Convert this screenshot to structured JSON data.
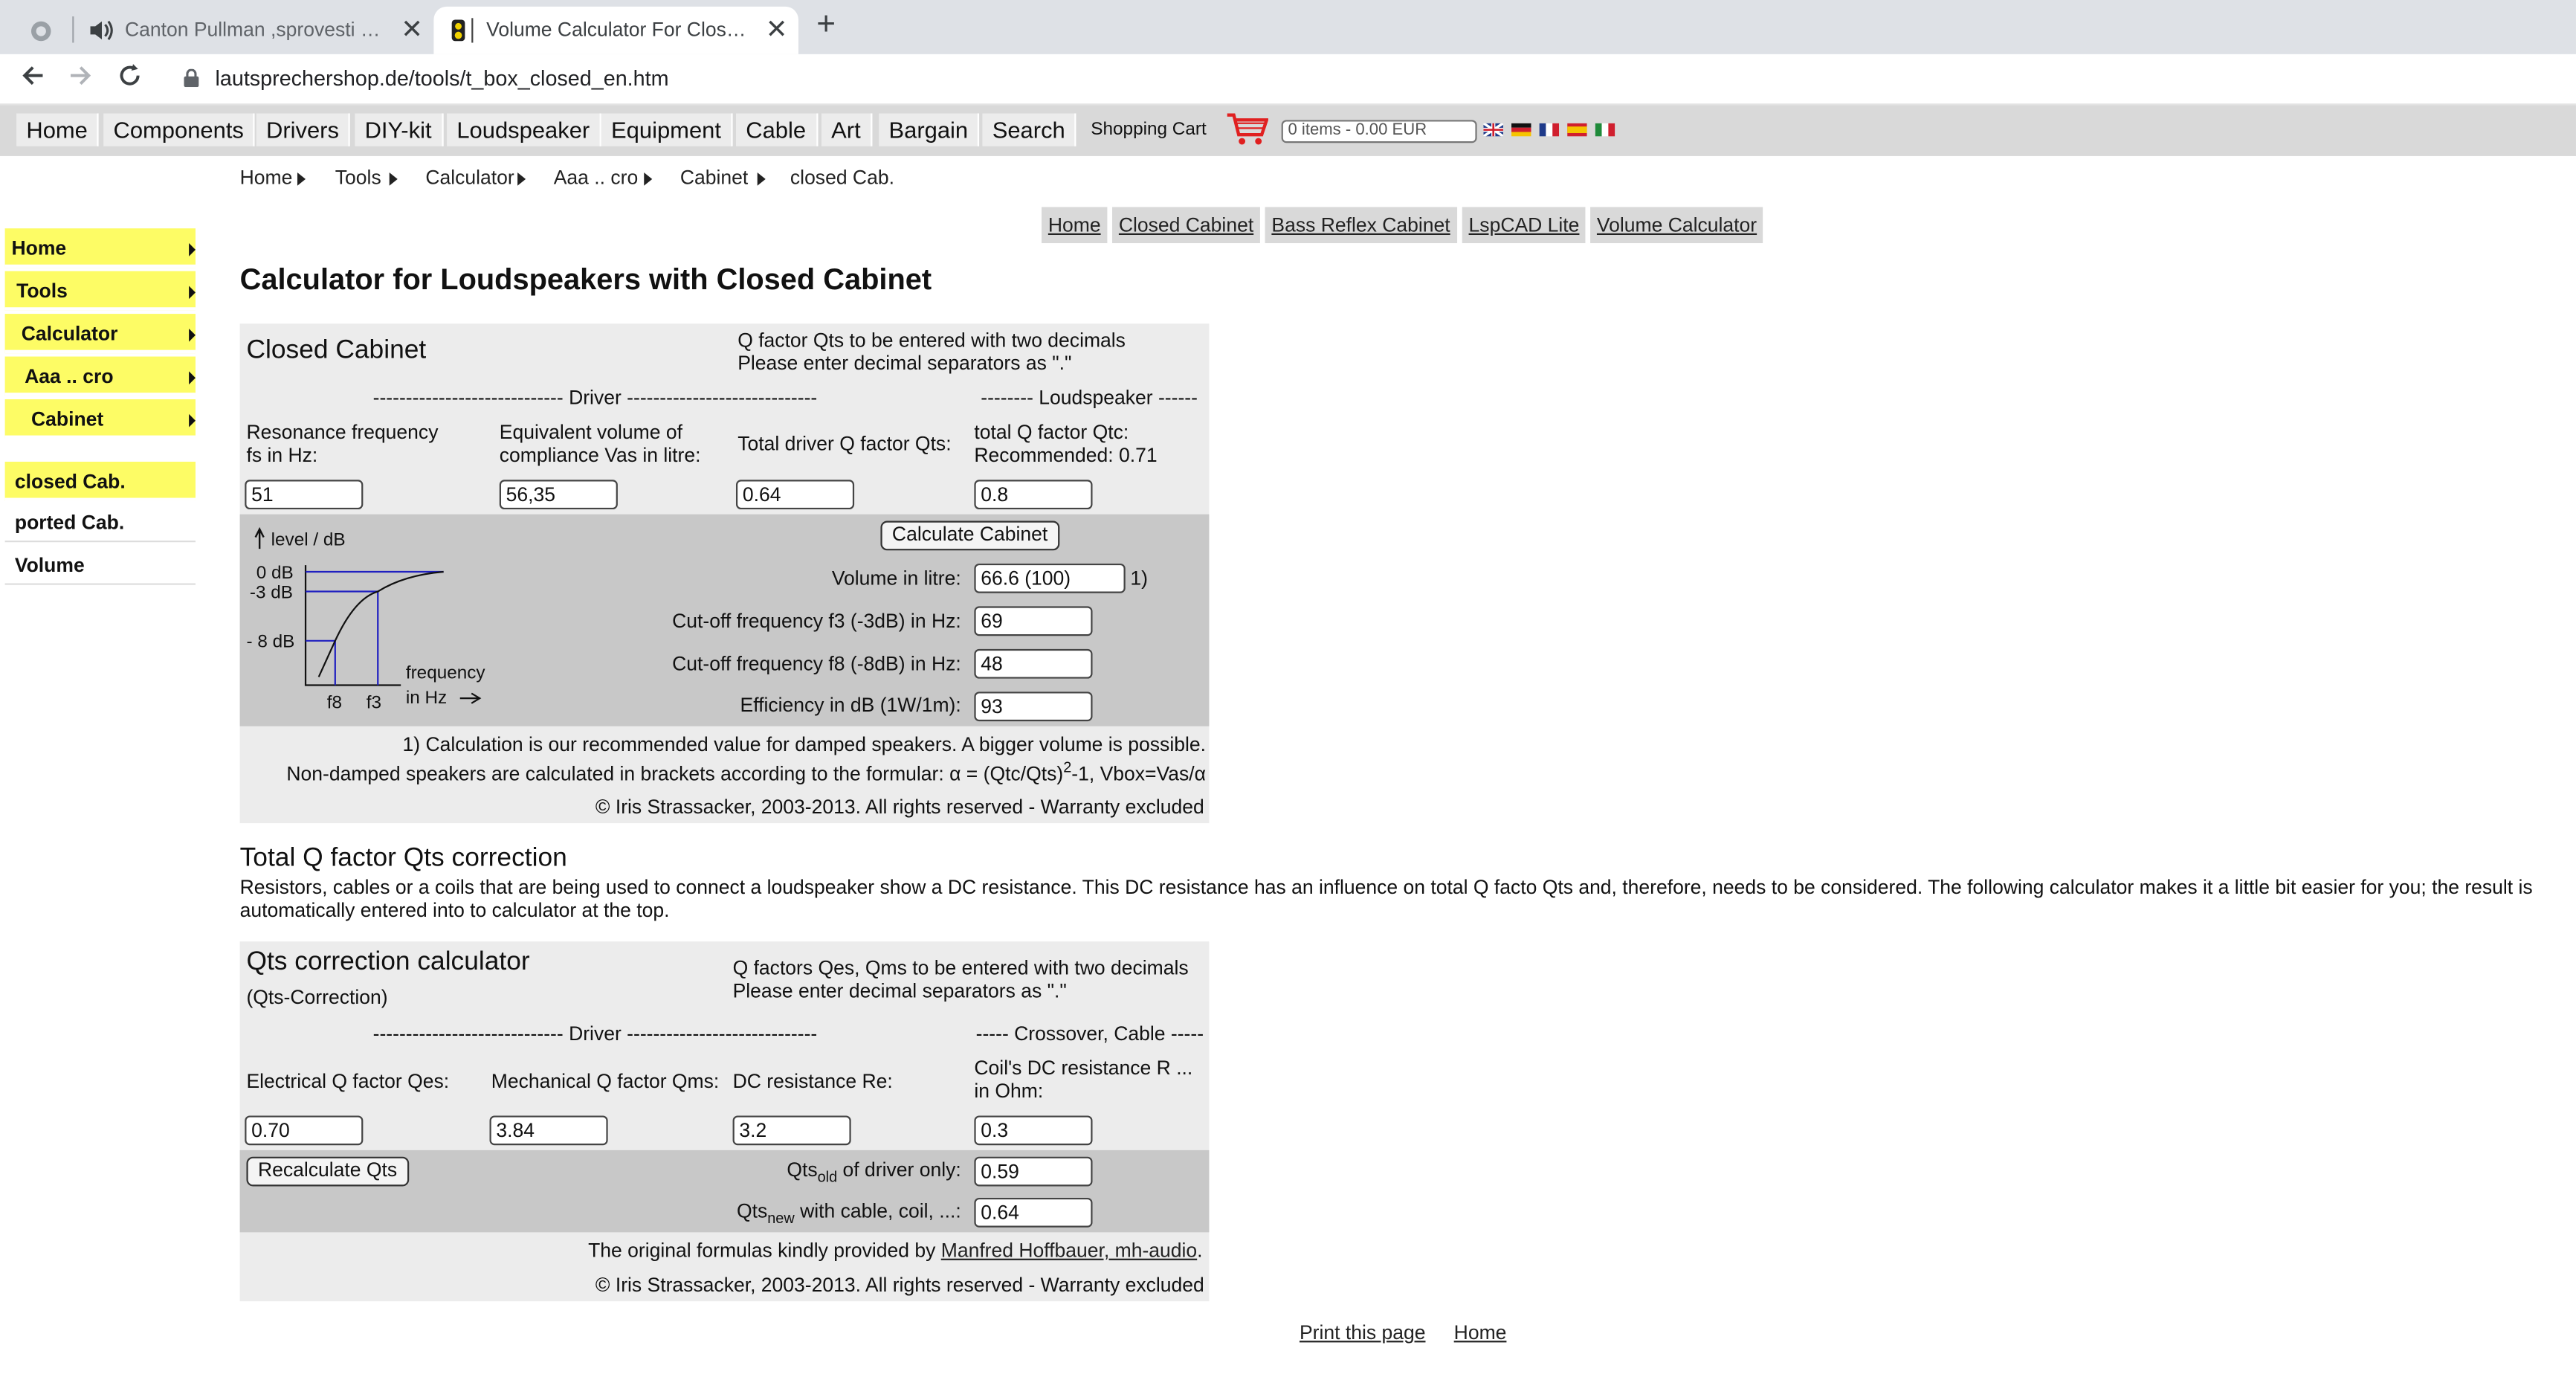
{
  "browser": {
    "tabs": [
      {
        "title": "Canton Pullman ,sprovesti u deld",
        "close": "✕"
      },
      {
        "title": "Volume Calculator For Closed Ca",
        "close": "✕"
      }
    ],
    "new_tab": "+",
    "url": "lautsprechershop.de/tools/t_box_closed_en.htm"
  },
  "topnav": {
    "items": [
      "Home",
      "Components",
      "Drivers",
      "DIY-kit",
      "Loudspeaker",
      "Equipment",
      "Cable",
      "Art",
      "Bargain",
      "Search"
    ],
    "cart_label": "Shopping Cart",
    "cart_value": "0 items - 0.00 EUR"
  },
  "breadcrumb": [
    "Home",
    "Tools",
    "Calculator",
    "Aaa .. cro",
    "Cabinet",
    "closed Cab."
  ],
  "leftmenu": [
    "Home",
    "Tools",
    "Calculator",
    "Aaa .. cro",
    "Cabinet",
    "closed Cab.",
    "ported Cab.",
    "Volume"
  ],
  "subnav": [
    "Home",
    "Closed Cabinet",
    "Bass Reflex Cabinet",
    "LspCAD Lite",
    "Volume Calculator"
  ],
  "page_title": "Calculator for Loudspeakers with Closed Cabinet",
  "closed": {
    "heading": "Closed Cabinet",
    "note1": "Q factor Qts to be entered with two decimals",
    "note2": "Please enter decimal separators as \".\"",
    "driver_divider": "----------------------------- Driver -----------------------------",
    "speaker_divider": "-------- Loudspeaker ------",
    "fs_label1": "Resonance frequency",
    "fs_label2": "fs in Hz:",
    "vas_label1": "Equivalent volume of",
    "vas_label2": "compliance Vas in litre:",
    "qts_label": "Total driver Q factor Qts:",
    "qtc_label1": "total Q factor Qtc:",
    "qtc_label2": "Recommended: 0.71",
    "fs": "51",
    "vas": "56,35",
    "qts": "0.64",
    "qtc": "0.8",
    "calc_button": "Calculate Cabinet",
    "volume_label": "Volume in litre:",
    "volume": "66.6 (100)",
    "volume_note": "1)",
    "f3_label": "Cut-off frequency f3 (-3dB) in Hz:",
    "f3": "69",
    "f8_label": "Cut-off frequency f8 (-8dB) in Hz:",
    "f8": "48",
    "eff_label": "Efficiency in dB (1W/1m):",
    "eff": "93",
    "graph": {
      "level": "level  / dB",
      "db0": "0 dB",
      "db3": "-3 dB",
      "db8": "- 8 dB",
      "freq": "frequency",
      "hz": "in Hz",
      "f8": "f8",
      "f3": "f3"
    },
    "footnote1": "1) Calculation is our recommended value for damped speakers. A bigger volume is possible.",
    "footnote2": "Non-damped speakers are calculated in brackets according to the formular: α = (Qtc/Qts)",
    "footnote2_sup": "2",
    "footnote2_end": "-1, Vbox=Vas/α",
    "copyright": "© Iris Strassacker, 2003-2013. All rights reserved - Warranty excluded"
  },
  "qts_section": {
    "title": "Total Q factor Qts correction",
    "description": "Resistors, cables or a coils that are being used to connect a loudspeaker show a DC resistance. This DC resistance has an influence on total Q facto Qts and, therefore, needs to be considered. The following calculator makes it a little bit easier for you; the result is automatically entered into to calculator at the top."
  },
  "qtscalc": {
    "heading": "Qts correction calculator",
    "subheading": "(Qts-Correction)",
    "note1": "Q factors Qes, Qms to be entered with two decimals",
    "note2": "Please enter decimal separators as \".\"",
    "driver_divider": "----------------------------- Driver -----------------------------",
    "crossover_divider": "----- Crossover, Cable -----",
    "qes_label": "Electrical Q factor Qes:",
    "qms_label": "Mechanical Q factor Qms:",
    "re_label": "DC resistance Re:",
    "r_label1": "Coil's DC resistance R ...",
    "r_label2": "in Ohm:",
    "qes": "0.70",
    "qms": "3.84",
    "re": "3.2",
    "r": "0.3",
    "button": "Recalculate Qts",
    "qts_old_label_a": "Qts",
    "qts_old_sub": "old",
    "qts_old_label_b": " of driver only:",
    "qts_old": "0.59",
    "qts_new_label_a": "Qts",
    "qts_new_sub": "new",
    "qts_new_label_b": " with cable, coil, ...:",
    "qts_new": "0.64",
    "credit_prefix": "The original formulas kindly provided by ",
    "credit_link": "Manfred Hoffbauer, mh-audio",
    "credit_suffix": ".",
    "copyright": "© Iris Strassacker, 2003-2013. All rights reserved - Warranty excluded"
  },
  "footer": {
    "print": "Print this page",
    "home": "Home"
  }
}
